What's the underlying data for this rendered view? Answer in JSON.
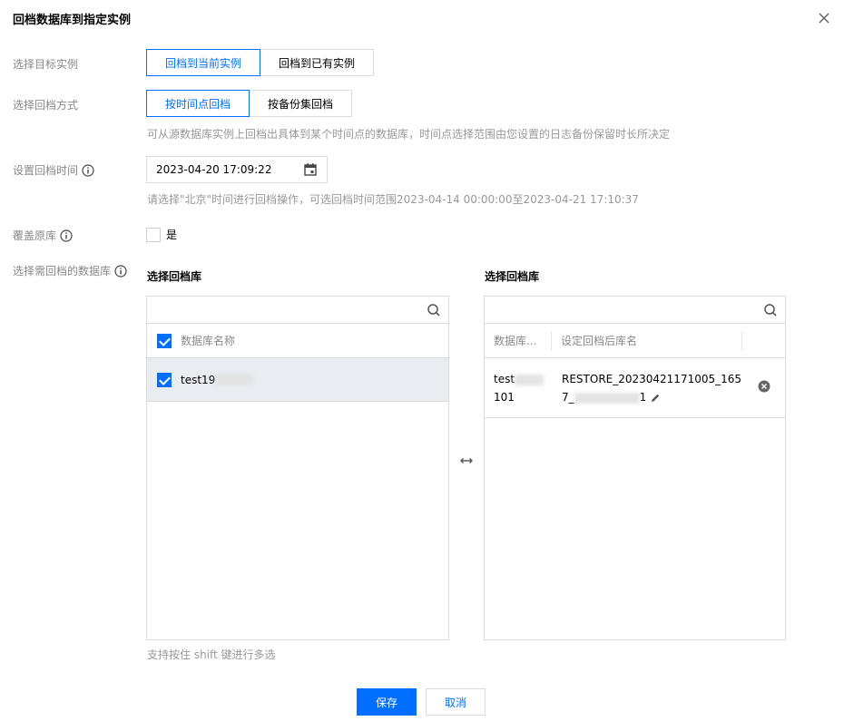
{
  "dialog": {
    "title": "回档数据库到指定实例"
  },
  "target_instance": {
    "label": "选择目标实例",
    "options": [
      "回档到当前实例",
      "回档到已有实例"
    ],
    "selected": "回档到当前实例"
  },
  "rollback_mode": {
    "label": "选择回档方式",
    "options": [
      "按时间点回档",
      "按备份集回档"
    ],
    "selected": "按时间点回档",
    "hint": "可从源数据库实例上回档出具体到某个时间点的数据库，时间点选择范围由您设置的日志备份保留时长所决定"
  },
  "rollback_time": {
    "label": "设置回档时间",
    "value": "2023-04-20 17:09:22",
    "hint": "请选择\"北京\"时间进行回档操作，可选回档时间范围2023-04-14 00:00:00至2023-04-21 17:10:37"
  },
  "override": {
    "label": "覆盖原库",
    "checkbox_label": "是",
    "checked": false
  },
  "db_select": {
    "label": "选择需回档的数据库",
    "left_title": "选择回档库",
    "right_title": "选择回档库",
    "left_header": "数据库名称",
    "left_rows": [
      {
        "name": "test19",
        "checked": true
      }
    ],
    "right_headers": [
      "数据库...",
      "设定回档后库名"
    ],
    "right_rows": [
      {
        "db_line1": "test",
        "db_line2": "101",
        "new_name_line1": "RESTORE_20230421171005_165",
        "new_name_line2_prefix": "7_",
        "new_name_line2_suffix": "1"
      }
    ],
    "footer_hint": "支持按住 shift 键进行多选"
  },
  "buttons": {
    "save": "保存",
    "cancel": "取消"
  },
  "colors": {
    "accent": "#006eff",
    "border": "#dcdcdc",
    "muted": "#888888",
    "row_selected": "#e9ecf1"
  }
}
